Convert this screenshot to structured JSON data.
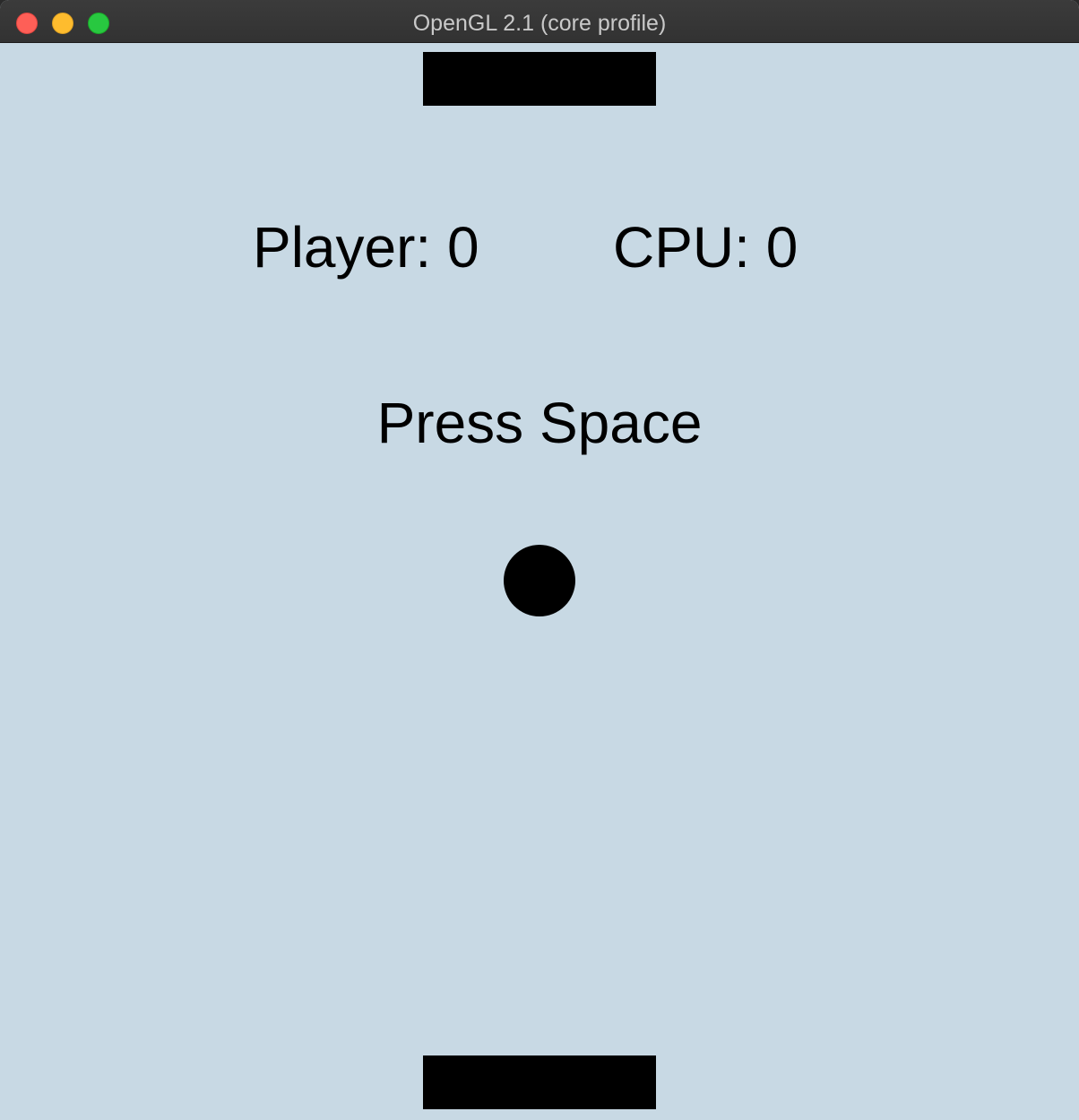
{
  "window": {
    "title": "OpenGL 2.1 (core profile)",
    "colors": {
      "background": "#c8d9e4",
      "foreground": "#000000",
      "titlebar": "#363636"
    }
  },
  "game": {
    "scoreboard": {
      "player_label": "Player: 0",
      "cpu_label": "CPU: 0",
      "player_score": 0,
      "cpu_score": 0
    },
    "prompt": "Press Space"
  }
}
